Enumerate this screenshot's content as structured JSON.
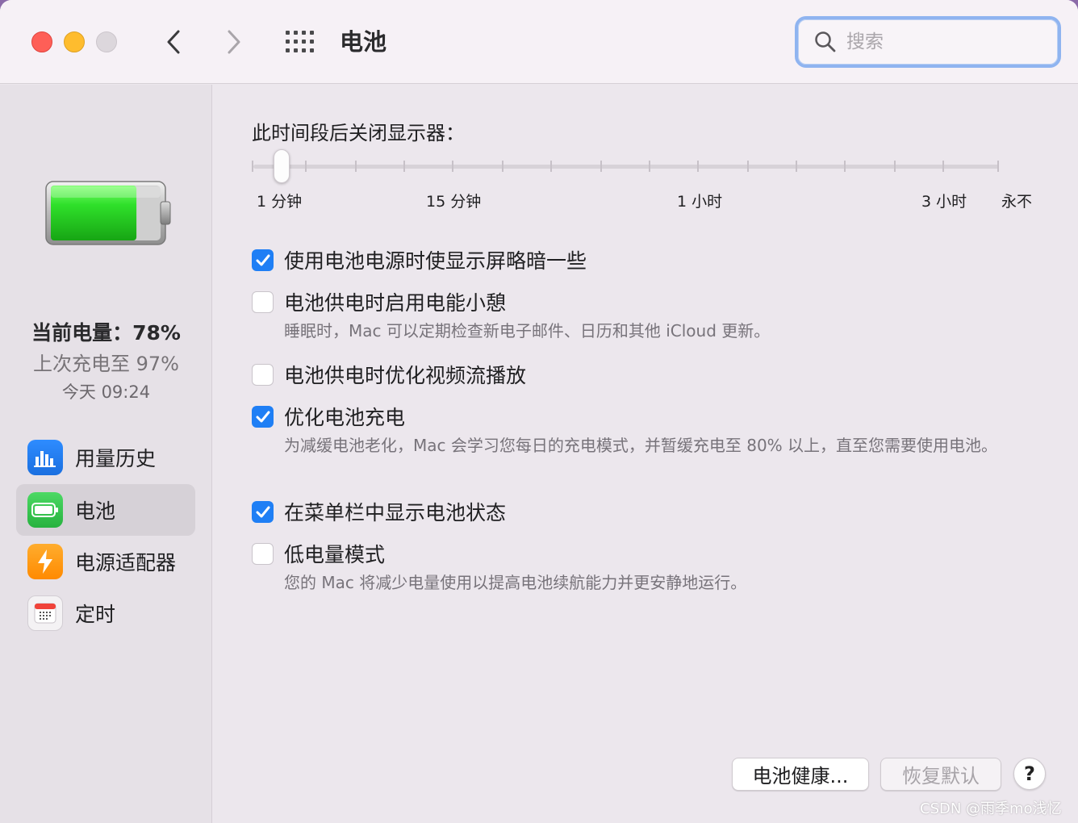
{
  "window": {
    "title": "电池",
    "search_placeholder": "搜索"
  },
  "sidebar": {
    "battery_level_label": "当前电量：78%",
    "last_charged": "上次充电至 97%",
    "last_charged_time": "今天 09:24",
    "battery_fill_percent": 78,
    "items": [
      {
        "label": "用量历史",
        "icon": "bar-chart-icon",
        "color": "#1a7cf5"
      },
      {
        "label": "电池",
        "icon": "battery-icon",
        "color": "#34c759",
        "active": true
      },
      {
        "label": "电源适配器",
        "icon": "bolt-icon",
        "color": "#ff9500"
      },
      {
        "label": "定时",
        "icon": "calendar-icon",
        "color": "#f2f0f2"
      }
    ]
  },
  "main": {
    "display_off_label": "此时间段后关闭显示器：",
    "slider_ticks": [
      "1 分钟",
      "15 分钟",
      "1 小时",
      "3 小时",
      "永不"
    ],
    "options": [
      {
        "label": "使用电池电源时使显示屏略暗一些",
        "checked": true,
        "desc": ""
      },
      {
        "label": "电池供电时启用电能小憩",
        "checked": false,
        "desc": "睡眠时，Mac 可以定期检查新电子邮件、日历和其他 iCloud 更新。"
      },
      {
        "label": "电池供电时优化视频流播放",
        "checked": false,
        "desc": ""
      },
      {
        "label": "优化电池充电",
        "checked": true,
        "desc": "为减缓电池老化，Mac 会学习您每日的充电模式，并暂缓充电至 80% 以上，直至您需要使用电池。"
      },
      {
        "label": "在菜单栏中显示电池状态",
        "checked": true,
        "desc": ""
      },
      {
        "label": "低电量模式",
        "checked": false,
        "desc": "您的 Mac 将减少电量使用以提高电池续航能力并更安静地运行。"
      }
    ],
    "buttons": {
      "battery_health": "电池健康...",
      "restore_defaults": "恢复默认",
      "help": "?"
    }
  },
  "watermark": "CSDN @雨季mo浅忆",
  "colors": {
    "accent": "#1f7ff5",
    "battery_green": "#2bd12b"
  }
}
